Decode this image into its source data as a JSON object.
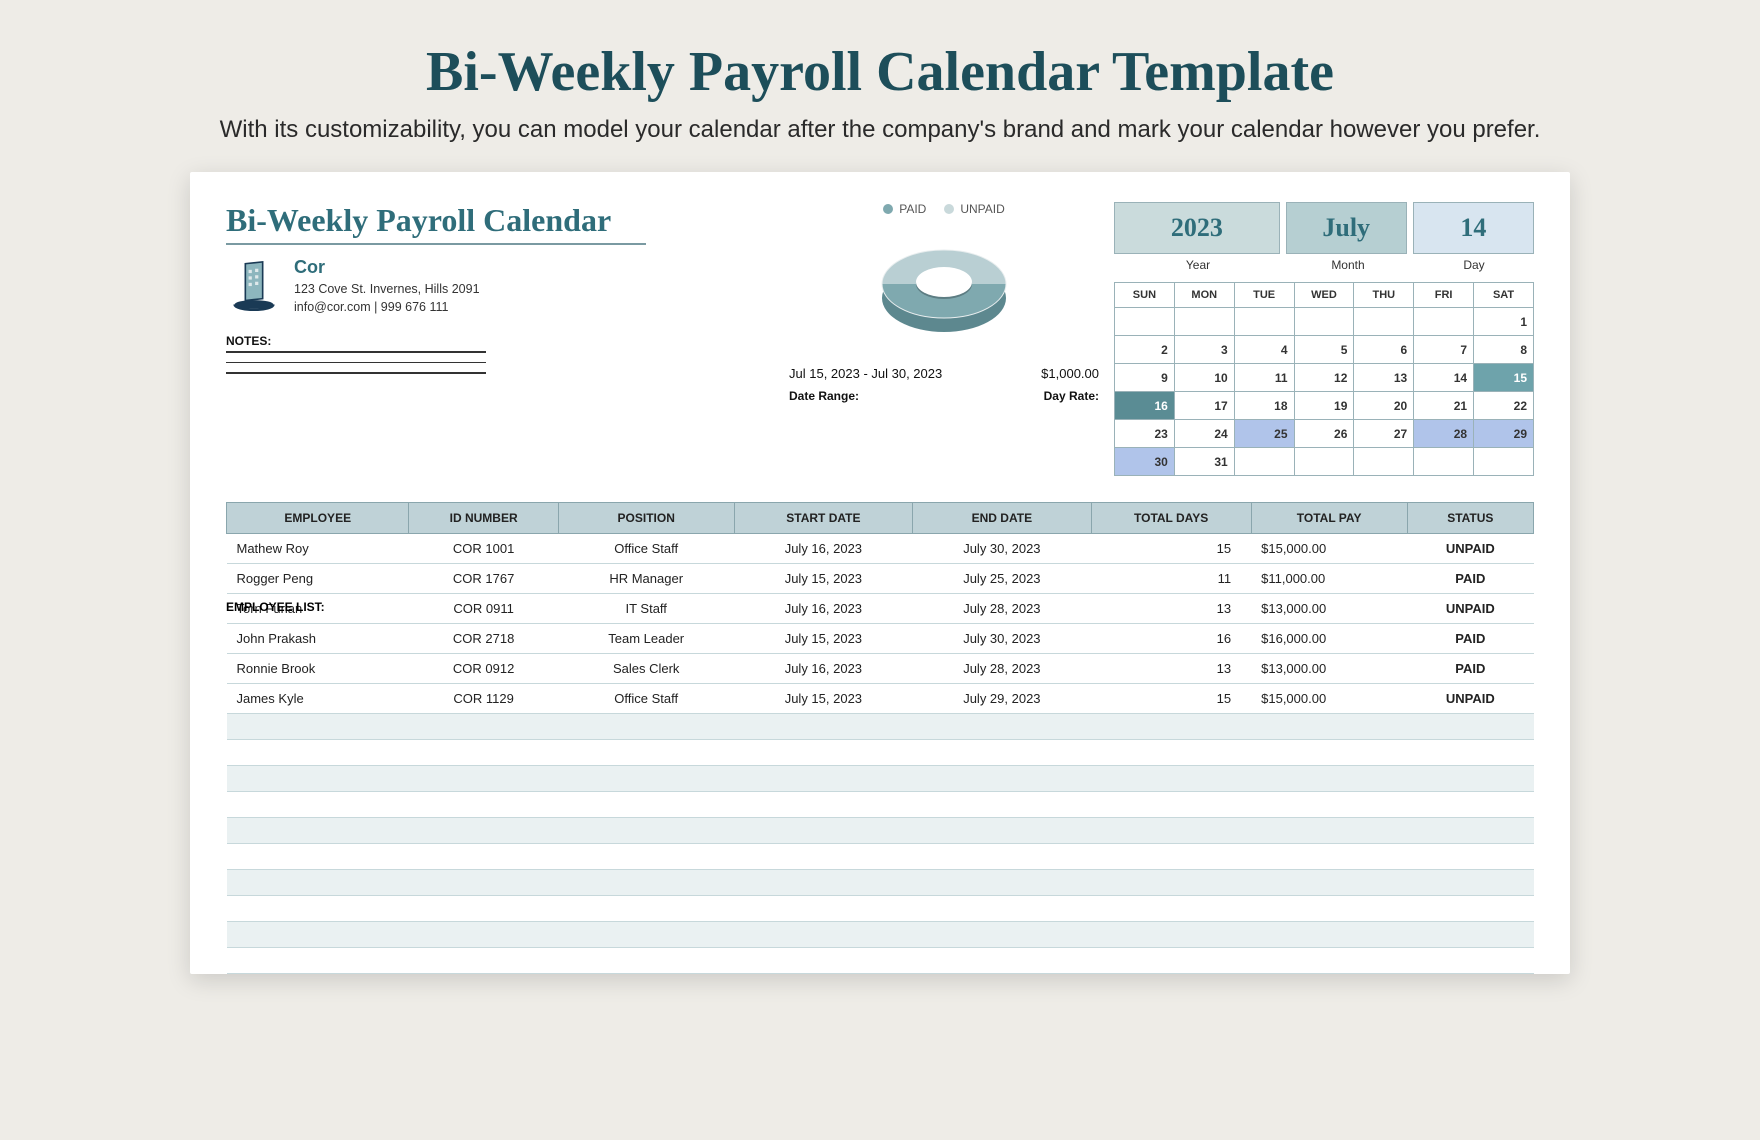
{
  "page": {
    "title": "Bi-Weekly Payroll Calendar Template",
    "subtitle": "With its customizability, you can model your calendar after the company's brand and mark your calendar however you prefer."
  },
  "sheet": {
    "title": "Bi-Weekly Payroll Calendar",
    "company": {
      "name": "Cor",
      "address": "123 Cove St. Invernes, Hills 2091",
      "contact": "info@cor.com | 999 676 111"
    },
    "notes_label": "NOTES:",
    "legend": {
      "paid": "PAID",
      "unpaid": "UNPAID"
    },
    "date_range_value": "Jul 15, 2023 - Jul 30, 2023",
    "day_rate_value": "$1,000.00",
    "date_range_label": "Date Range:",
    "day_rate_label": "Day Rate:",
    "ymd": {
      "year": "2023",
      "month": "July",
      "day": "14",
      "year_label": "Year",
      "month_label": "Month",
      "day_label": "Day"
    },
    "calendar": {
      "dow": [
        "SUN",
        "MON",
        "TUE",
        "WED",
        "THU",
        "FRI",
        "SAT"
      ],
      "weeks": [
        [
          {
            "n": ""
          },
          {
            "n": ""
          },
          {
            "n": ""
          },
          {
            "n": ""
          },
          {
            "n": ""
          },
          {
            "n": ""
          },
          {
            "n": "1"
          }
        ],
        [
          {
            "n": "2"
          },
          {
            "n": "3"
          },
          {
            "n": "4"
          },
          {
            "n": "5"
          },
          {
            "n": "6"
          },
          {
            "n": "7"
          },
          {
            "n": "8"
          }
        ],
        [
          {
            "n": "9"
          },
          {
            "n": "10"
          },
          {
            "n": "11"
          },
          {
            "n": "12"
          },
          {
            "n": "13"
          },
          {
            "n": "14"
          },
          {
            "n": "15",
            "cls": "hl-teal"
          }
        ],
        [
          {
            "n": "16",
            "cls": "hl-dark"
          },
          {
            "n": "17"
          },
          {
            "n": "18"
          },
          {
            "n": "19"
          },
          {
            "n": "20"
          },
          {
            "n": "21"
          },
          {
            "n": "22"
          }
        ],
        [
          {
            "n": "23"
          },
          {
            "n": "24"
          },
          {
            "n": "25",
            "cls": "hl-blue"
          },
          {
            "n": "26"
          },
          {
            "n": "27"
          },
          {
            "n": "28",
            "cls": "hl-blue"
          },
          {
            "n": "29",
            "cls": "hl-blue"
          }
        ],
        [
          {
            "n": "30",
            "cls": "hl-blue"
          },
          {
            "n": "31"
          },
          {
            "n": ""
          },
          {
            "n": ""
          },
          {
            "n": ""
          },
          {
            "n": ""
          },
          {
            "n": ""
          }
        ]
      ]
    },
    "emp_list_label": "EMPLOYEE LIST:",
    "columns": [
      "EMPLOYEE",
      "ID NUMBER",
      "POSITION",
      "START DATE",
      "END DATE",
      "TOTAL DAYS",
      "TOTAL PAY",
      "STATUS"
    ],
    "rows": [
      {
        "employee": "Mathew Roy",
        "id": "COR 1001",
        "position": "Office Staff",
        "start": "July 16, 2023",
        "end": "July 30, 2023",
        "days": "15",
        "pay": "15,000.00",
        "status": "UNPAID"
      },
      {
        "employee": "Rogger Peng",
        "id": "COR 1767",
        "position": "HR Manager",
        "start": "July 15, 2023",
        "end": "July 25, 2023",
        "days": "11",
        "pay": "11,000.00",
        "status": "PAID"
      },
      {
        "employee": "Torn Furlan",
        "id": "COR 0911",
        "position": "IT Staff",
        "start": "July 16, 2023",
        "end": "July 28, 2023",
        "days": "13",
        "pay": "13,000.00",
        "status": "UNPAID"
      },
      {
        "employee": "John Prakash",
        "id": "COR 2718",
        "position": "Team Leader",
        "start": "July 15, 2023",
        "end": "July 30, 2023",
        "days": "16",
        "pay": "16,000.00",
        "status": "PAID"
      },
      {
        "employee": "Ronnie Brook",
        "id": "COR 0912",
        "position": "Sales Clerk",
        "start": "July 16, 2023",
        "end": "July 28, 2023",
        "days": "13",
        "pay": "13,000.00",
        "status": "PAID"
      },
      {
        "employee": "James Kyle",
        "id": "COR  1129",
        "position": "Office Staff",
        "start": "July 15, 2023",
        "end": "July 29, 2023",
        "days": "15",
        "pay": "15,000.00",
        "status": "UNPAID"
      }
    ],
    "empty_rows": 10
  },
  "chart_data": {
    "type": "pie",
    "title": "",
    "series": [
      {
        "name": "PAID",
        "value": 3,
        "color": "#7fa9af"
      },
      {
        "name": "UNPAID",
        "value": 3,
        "color": "#b9cfd3"
      }
    ]
  },
  "colors": {
    "teal": "#2f6d7a",
    "header_bg": "#bfd2d7",
    "paid": "#3bab4a",
    "unpaid": "#d13a3a"
  }
}
